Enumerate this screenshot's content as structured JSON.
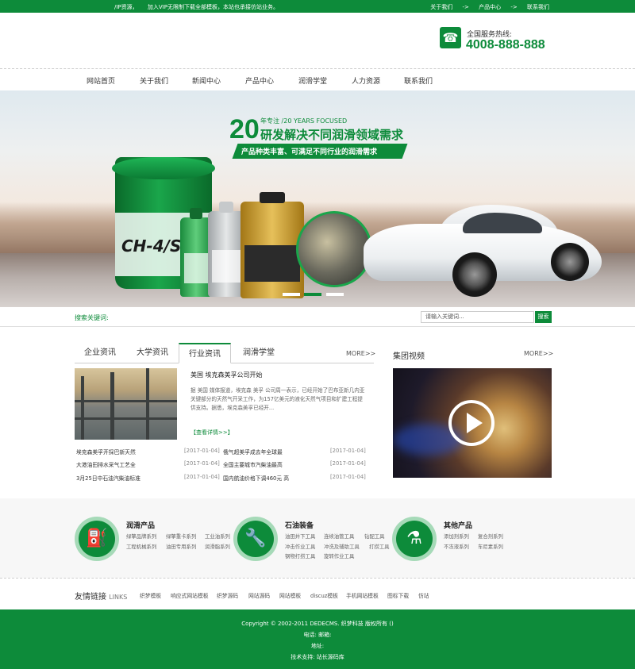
{
  "topbar": {
    "left": [
      "/IP资源，",
      "加入VIP无限制下载全部模板，本站也承接仿站业务。"
    ],
    "right": [
      "关于我们",
      "->",
      "产品中心",
      "->",
      "联系我们"
    ]
  },
  "header": {
    "hotline_label": "全国服务热线:",
    "hotline_number": "4008-888-888",
    "phone_icon": "☎"
  },
  "nav": [
    "网站首页",
    "关于我们",
    "新闻中心",
    "产品中心",
    "润滑学堂",
    "人力资源",
    "联系我们"
  ],
  "banner": {
    "number": "20",
    "sub": "年专注 /20 YEARS FOCUSED",
    "title": "研发解决不同润滑领域需求",
    "ribbon": "产品种类丰富、可满足不同行业的润滑需求",
    "bucket_text": "CH-4/S",
    "slides": 3,
    "active_slide": 2
  },
  "search": {
    "label": "搜索关键词:",
    "placeholder": "请输入关键词...",
    "button": "搜索"
  },
  "news": {
    "tabs": [
      "企业资讯",
      "大学资讯",
      "行业资讯",
      "润滑学堂"
    ],
    "active_tab": 2,
    "more": "MORE>>",
    "featured_title": "美国 埃克森美孚公司开始",
    "featured_desc": "据 美国 媒体报道，埃克森 美孚 公司周一表示，已经开始了巴布亚新几内亚关键部分的天然气开采工作，为157亿美元的液化天然气项目和扩建工程提供支持。据悉，埃克森美孚已经开...",
    "featured_more": "【查看详情>>】",
    "left_list": [
      {
        "title": "埃克森美孚开採巴新天然",
        "date": "[2017-01-04]"
      },
      {
        "title": "大港油田排水采气工艺全",
        "date": "[2017-01-04]"
      },
      {
        "title": "3月25日中石油汽柴油标准",
        "date": "[2017-01-04]"
      }
    ],
    "right_list": [
      {
        "title": "俄气超美孚成去年全球最",
        "date": "[2017-01-04]"
      },
      {
        "title": "全国主要城市汽柴油最高",
        "date": "[2017-01-04]"
      },
      {
        "title": "国内航油价格下调460元 高",
        "date": "[2017-01-04]"
      }
    ]
  },
  "video": {
    "title": "集团视频",
    "more": "MORE>>"
  },
  "products": [
    {
      "title": "润滑产品",
      "icon": "oil-can-icon",
      "glyph": "⛽",
      "links": [
        [
          "绿擎品牌系列",
          "绿擎重卡系列",
          "工业油系列"
        ],
        [
          "工程机械系列",
          "油田专用系列",
          "润滑脂系列"
        ]
      ]
    },
    {
      "title": "石油装备",
      "icon": "wrench-icon",
      "glyph": "🔧",
      "links": [
        [
          "油田井下工具",
          "连续油管工具",
          "钻配工具"
        ],
        [
          "冲击作业工具",
          "冲洗及辅助工具",
          "打捞工具"
        ],
        [
          "钢物打捞工具",
          "旋转作业工具"
        ]
      ]
    },
    {
      "title": "其他产品",
      "icon": "flask-icon",
      "glyph": "⚗",
      "links": [
        [
          "添加剂系列",
          "复合剂系列"
        ],
        [
          "不冻液系列",
          "车尼素系列"
        ]
      ]
    }
  ],
  "friend_links": {
    "title": "友情链接",
    "title_en": "LINKS",
    "items": [
      "织梦模板",
      "响应式网站模板",
      "织梦源码",
      "网站源码",
      "网站模板",
      "discuz模板",
      "手机网站模板",
      "图标下载",
      "仿站"
    ]
  },
  "footer": {
    "copyright": "Copyright © 2002-2011 DEDECMS. 织梦科技 版权所有 ()",
    "contact": "电话:        邮箱:",
    "address": "地址:",
    "support": "技术支持: 站长源码库"
  },
  "colors": {
    "brand_green": "#0d8b3a",
    "light_green": "#a6dab8"
  }
}
